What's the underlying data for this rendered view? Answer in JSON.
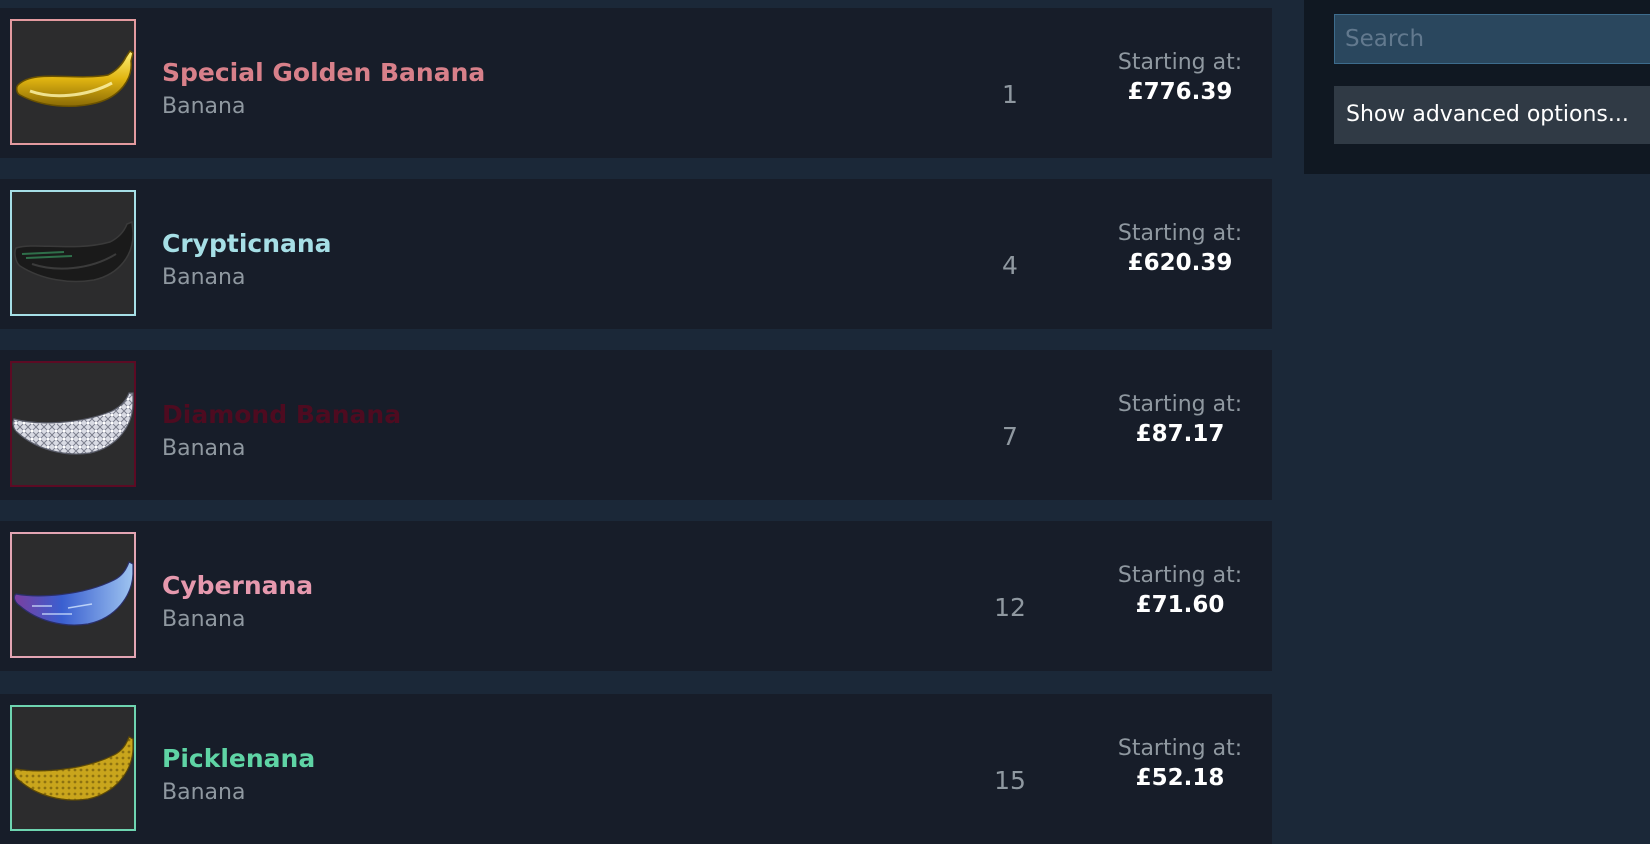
{
  "colors": {
    "page_bg": "#1b2838",
    "row_bg": "#171d29",
    "sidebar_bg": "#101822",
    "muted_text": "#8f98a0",
    "price_text": "#ffffff"
  },
  "listings": [
    {
      "name": "Special Golden Banana",
      "type": "Banana",
      "quantity": "1",
      "price_label": "Starting at:",
      "price": "£776.39",
      "name_color": "#d8808a",
      "border_color": "#e39a9f",
      "icon": "golden-banana-icon"
    },
    {
      "name": "Crypticnana",
      "type": "Banana",
      "quantity": "4",
      "price_label": "Starting at:",
      "price": "£620.39",
      "name_color": "#a6dfe6",
      "border_color": "#a6dfe6",
      "icon": "black-banana-icon"
    },
    {
      "name": "Diamond Banana",
      "type": "Banana",
      "quantity": "7",
      "price_label": "Starting at:",
      "price": "£87.17",
      "name_color": "#4e0b20",
      "border_color": "#5c0b24",
      "icon": "diamond-banana-icon"
    },
    {
      "name": "Cybernana",
      "type": "Banana",
      "quantity": "12",
      "price_label": "Starting at:",
      "price": "£71.60",
      "name_color": "#e699ae",
      "border_color": "#e3a5b3",
      "icon": "cyber-banana-icon"
    },
    {
      "name": "Picklenana",
      "type": "Banana",
      "quantity": "15",
      "price_label": "Starting at:",
      "price": "£52.18",
      "name_color": "#5fd4a5",
      "border_color": "#6ed4b0",
      "icon": "pickle-banana-icon"
    }
  ],
  "sidebar": {
    "search_placeholder": "Search",
    "advanced_options_label": "Show advanced options..."
  }
}
